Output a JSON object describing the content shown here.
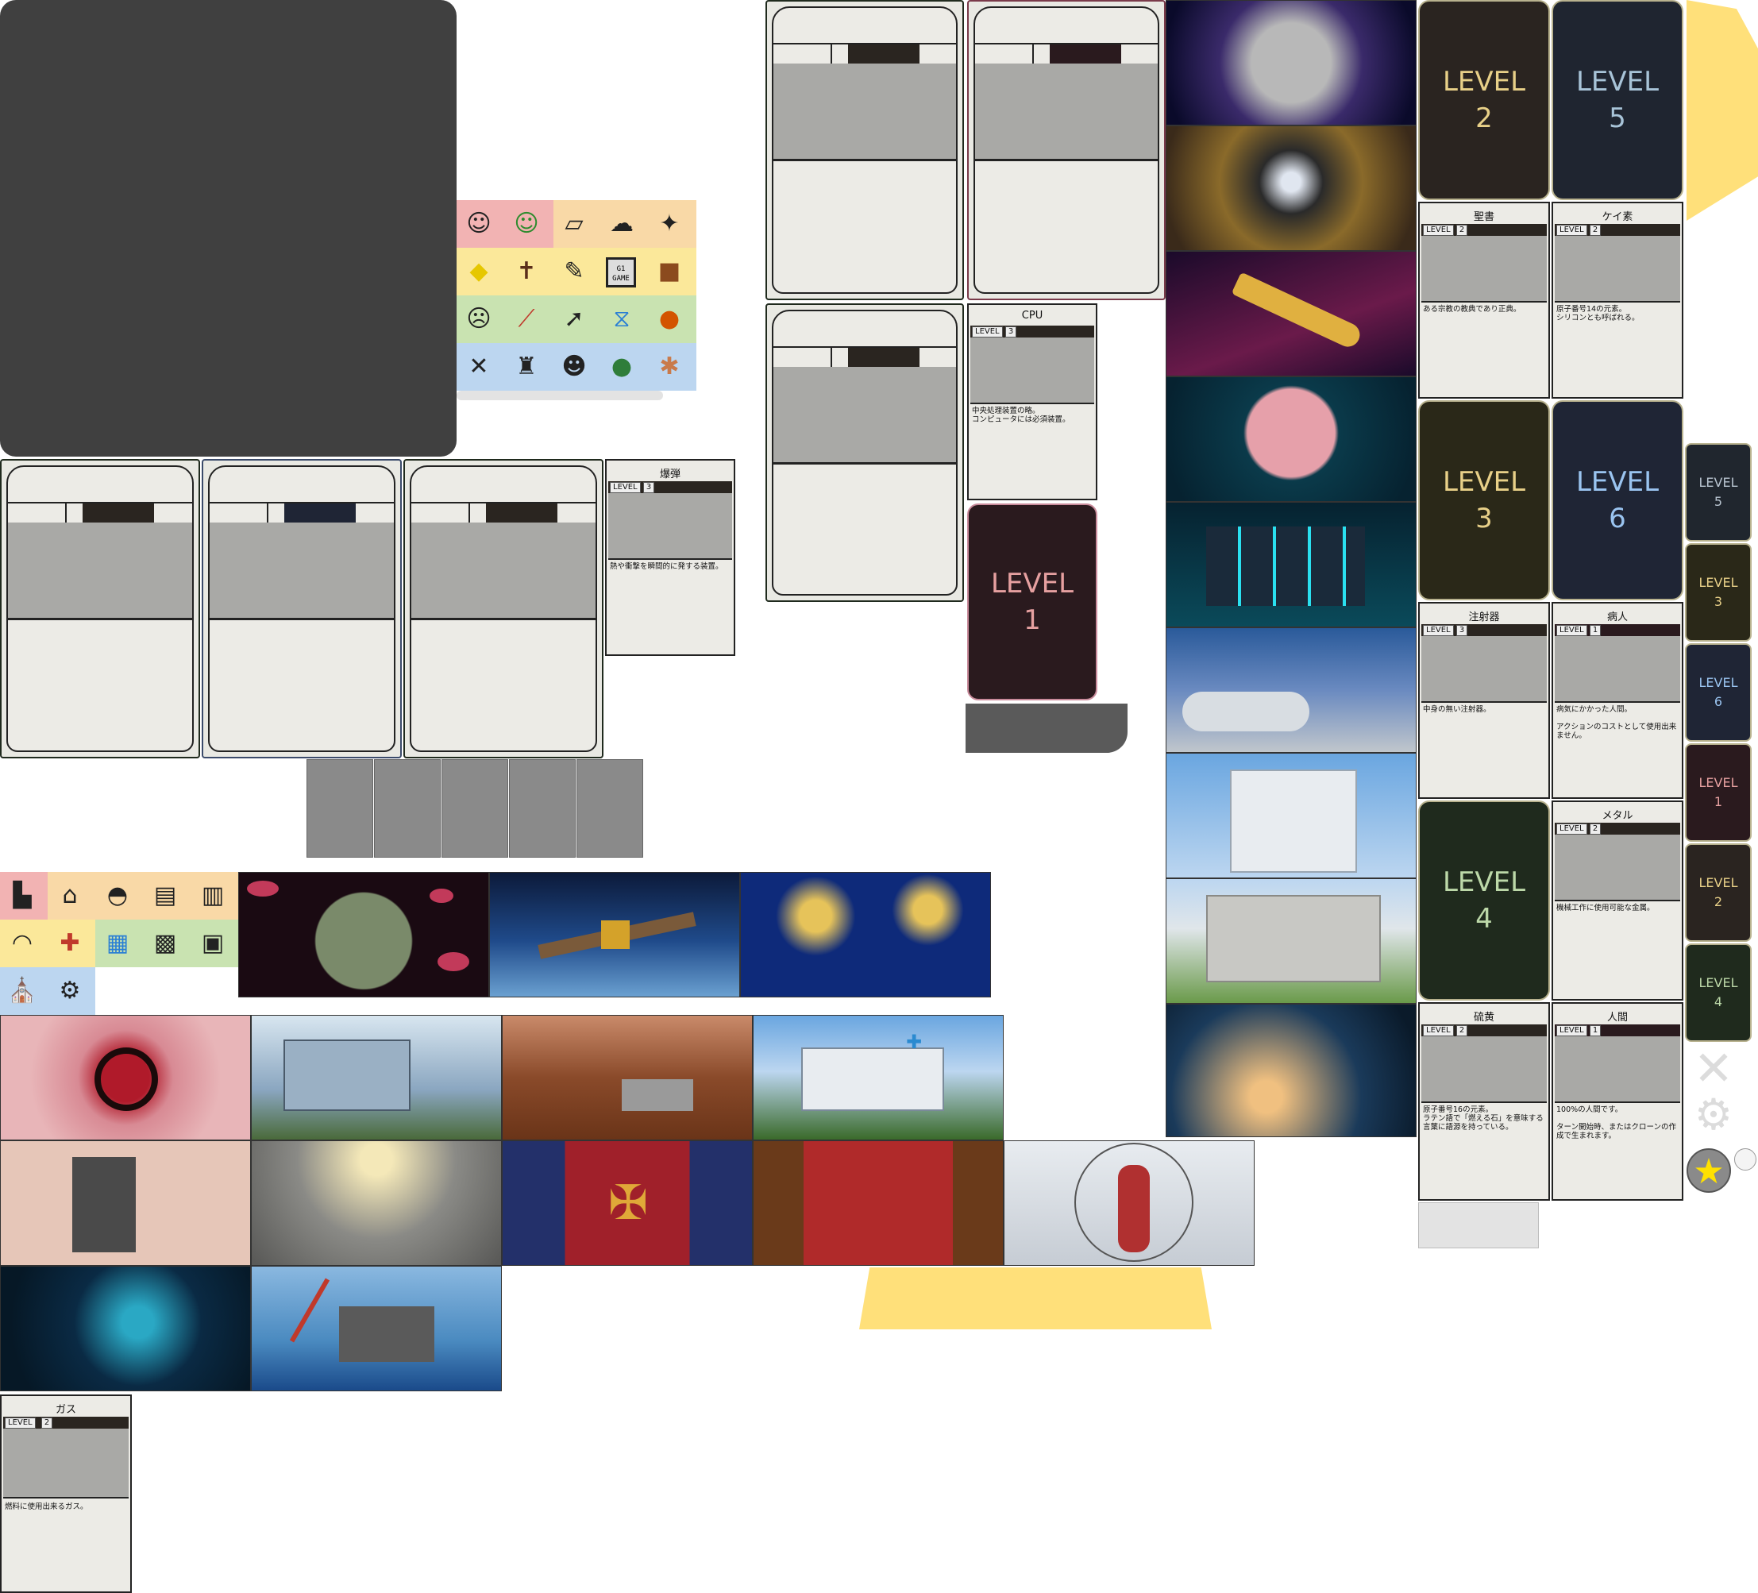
{
  "level_word": "LEVEL",
  "level_cards": {
    "l2": {
      "word": "LEVEL",
      "num": "2"
    },
    "l5": {
      "word": "LEVEL",
      "num": "5"
    },
    "l3": {
      "word": "LEVEL",
      "num": "3"
    },
    "l6": {
      "word": "LEVEL",
      "num": "6"
    },
    "l4": {
      "word": "LEVEL",
      "num": "4"
    },
    "l1": {
      "word": "LEVEL",
      "num": "1"
    }
  },
  "mini_level_cards": [
    {
      "word": "LEVEL",
      "num": "5"
    },
    {
      "word": "LEVEL",
      "num": "3"
    },
    {
      "word": "LEVEL",
      "num": "6"
    },
    {
      "word": "LEVEL",
      "num": "1"
    },
    {
      "word": "LEVEL",
      "num": "2"
    },
    {
      "word": "LEVEL",
      "num": "4"
    }
  ],
  "cards": {
    "bomb": {
      "title": "爆弾",
      "level_label": "LEVEL",
      "level": "3",
      "desc": "熱や衝撃を瞬間的に発する装置。"
    },
    "cpu": {
      "title": "CPU",
      "level_label": "LEVEL",
      "level": "3",
      "desc": "中央処理装置の略。\nコンピュータには必須装置。"
    },
    "bible": {
      "title": "聖書",
      "level_label": "LEVEL",
      "level": "2",
      "desc": "ある宗教の教典であり正典。"
    },
    "silicon": {
      "title": "ケイ素",
      "level_label": "LEVEL",
      "level": "2",
      "desc": "原子番号14の元素。\nシリコンとも呼ばれる。"
    },
    "syringe": {
      "title": "注射器",
      "level_label": "LEVEL",
      "level": "3",
      "desc": "中身の無い注射器。"
    },
    "patient": {
      "title": "病人",
      "level_label": "LEVEL",
      "level": "1",
      "desc": "病気にかかった人間。\n\nアクションのコストとして使用出来ません。"
    },
    "metal": {
      "title": "メタル",
      "level_label": "LEVEL",
      "level": "2",
      "desc": "機械工作に使用可能な金属。"
    },
    "sulfur": {
      "title": "硫黄",
      "level_label": "LEVEL",
      "level": "2",
      "desc": "原子番号16の元素。\nラテン語で「燃える石」を意味する言葉に語源を持っている。"
    },
    "human": {
      "title": "人間",
      "level_label": "LEVEL",
      "level": "1",
      "desc": "100%の人間です。\n\nターン開始時、またはクローンの作成で生まれます。"
    },
    "gas": {
      "title": "ガス",
      "level_label": "LEVEL",
      "level": "2",
      "desc": "燃料に使用出来るガス。"
    }
  },
  "icon_chip_text": "G1\nGAME",
  "colors": {
    "dark_panel": "#404040",
    "card_dark": "#2a2520",
    "level_red": "#2a1a1e",
    "level_text_red": "#e6a0a0",
    "accent_yellow": "#ffe07a"
  }
}
